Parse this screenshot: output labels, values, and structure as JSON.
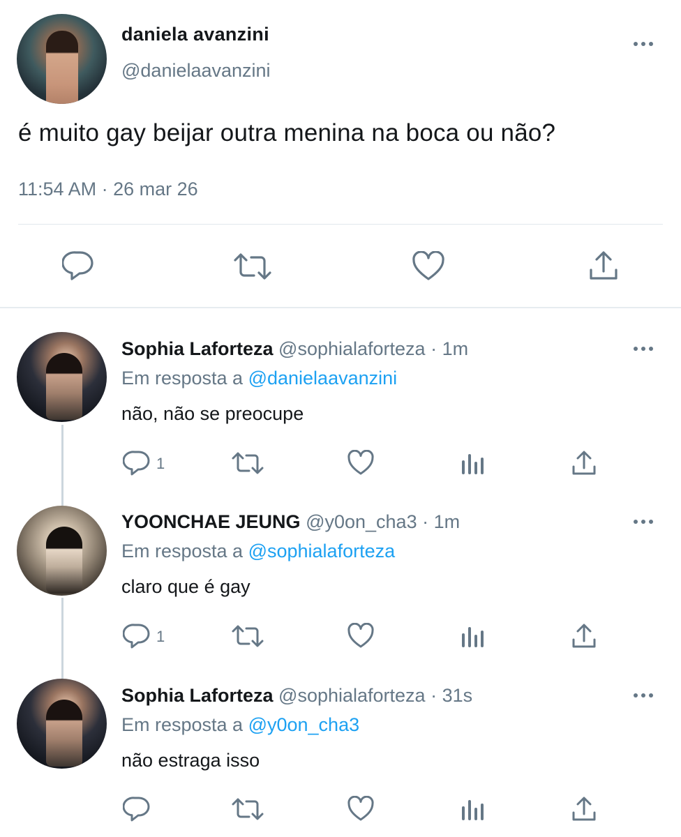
{
  "main_tweet": {
    "display_name": "daniela avanzini",
    "handle": "@danielaavanzini",
    "text": "é muito gay beijar outra menina na boca ou não?",
    "timestamp": "11:54 AM · 26 mar 26",
    "actions": [
      "reply-icon",
      "retweet-icon",
      "like-icon",
      "share-icon"
    ]
  },
  "replies": [
    {
      "display_name": "Sophia Laforteza",
      "handle": "@sophialaforteza",
      "sep": " · ",
      "time": "1m",
      "reply_prefix": "Em resposta a ",
      "reply_to": "@danielaavanzini",
      "text": "não, não se preocupe",
      "reply_count": "1"
    },
    {
      "display_name": "YOONCHAE JEUNG",
      "handle": "@y0on_cha3",
      "sep": " · ",
      "time": "1m",
      "reply_prefix": "Em resposta a ",
      "reply_to": "@sophialaforteza",
      "text": "claro que é gay",
      "reply_count": "1"
    },
    {
      "display_name": "Sophia Laforteza",
      "handle": "@sophialaforteza",
      "sep": " · ",
      "time": "31s",
      "reply_prefix": "Em resposta a ",
      "reply_to": "@y0on_cha3",
      "text": "não estraga isso",
      "reply_count": ""
    }
  ],
  "colors": {
    "text": "#14171a",
    "secondary": "#657786",
    "link": "#1da1f2",
    "divider": "#e1e8ed"
  }
}
